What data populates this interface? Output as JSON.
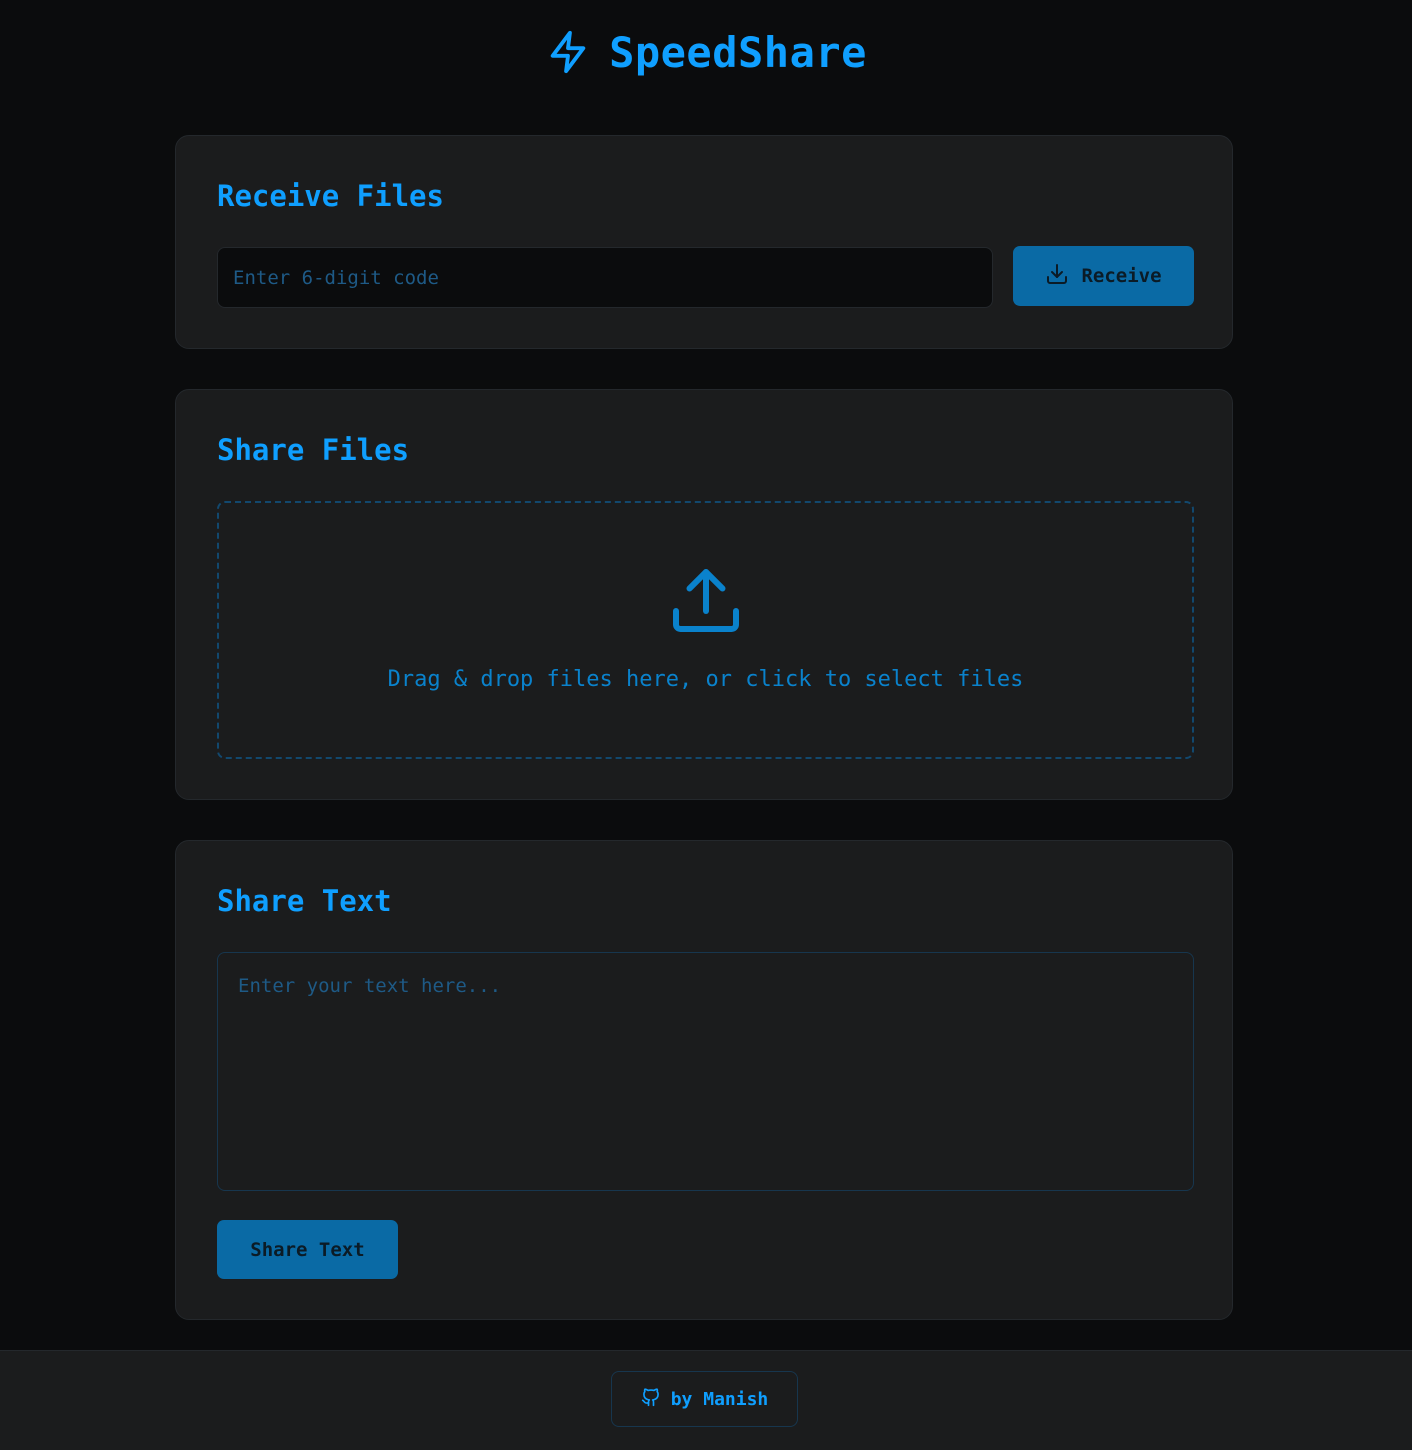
{
  "app": {
    "title": "SpeedShare",
    "logo_icon": "lightning-bolt-icon",
    "accent_color": "#0f9fff",
    "button_color": "#0a6aa5"
  },
  "receive": {
    "title": "Receive Files",
    "code_placeholder": "Enter 6-digit code",
    "code_value": "",
    "button_label": "Receive",
    "button_icon": "download-icon"
  },
  "share_files": {
    "title": "Share Files",
    "dropzone_icon": "upload-icon",
    "dropzone_text": "Drag & drop files here, or click to select files"
  },
  "share_text": {
    "title": "Share Text",
    "textarea_placeholder": "Enter your text here...",
    "textarea_value": "",
    "button_label": "Share Text"
  },
  "footer": {
    "credit_label": "by Manish",
    "credit_icon": "github-icon"
  }
}
